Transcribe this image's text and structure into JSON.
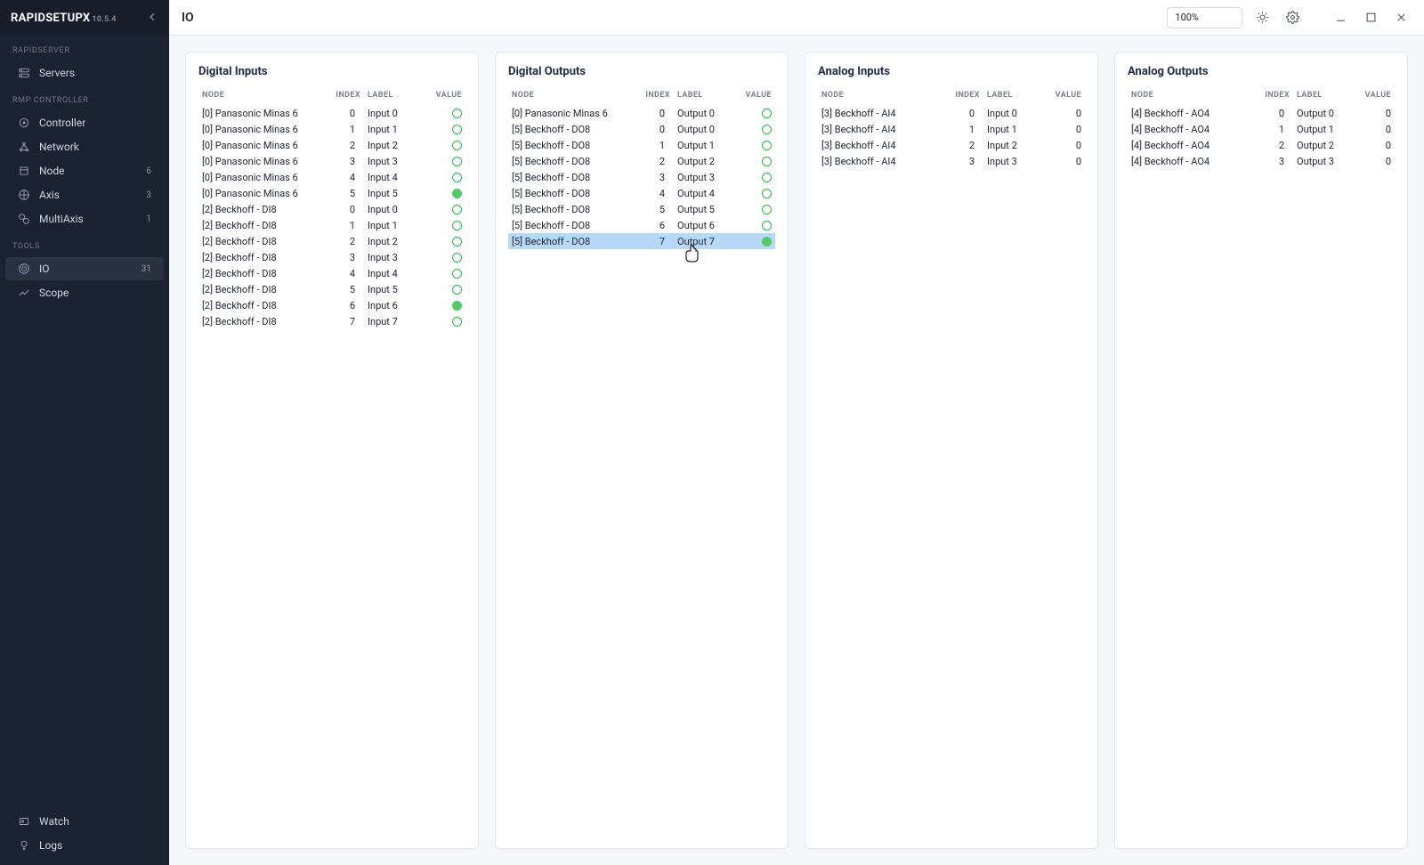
{
  "app": {
    "name": "RAPIDSETUPX",
    "version": "10.5.4",
    "page_title": "IO"
  },
  "zoom": {
    "level": "100%"
  },
  "sidebar": {
    "groups": [
      {
        "label": "RAPIDSERVER",
        "items": [
          {
            "id": "servers",
            "label": "Servers",
            "icon": "servers",
            "badge": "",
            "active": false
          }
        ]
      },
      {
        "label": "RMP CONTROLLER",
        "items": [
          {
            "id": "controller",
            "label": "Controller",
            "icon": "controller",
            "badge": "",
            "active": false
          },
          {
            "id": "network",
            "label": "Network",
            "icon": "network",
            "badge": "",
            "active": false
          },
          {
            "id": "node",
            "label": "Node",
            "icon": "node",
            "badge": "6",
            "active": false
          },
          {
            "id": "axis",
            "label": "Axis",
            "icon": "axis",
            "badge": "3",
            "active": false
          },
          {
            "id": "multiaxis",
            "label": "MultiAxis",
            "icon": "multiaxis",
            "badge": "1",
            "active": false
          }
        ]
      },
      {
        "label": "TOOLS",
        "items": [
          {
            "id": "io",
            "label": "IO",
            "icon": "io",
            "badge": "31",
            "active": true
          },
          {
            "id": "scope",
            "label": "Scope",
            "icon": "scope",
            "badge": "",
            "active": false
          }
        ]
      }
    ],
    "bottom": [
      {
        "id": "watch",
        "label": "Watch",
        "icon": "watch"
      },
      {
        "id": "logs",
        "label": "Logs",
        "icon": "logs"
      }
    ]
  },
  "headers": {
    "node": "NODE",
    "index": "INDEX",
    "label": "LABEL",
    "value": "VALUE"
  },
  "panels": [
    {
      "id": "din",
      "title": "Digital Inputs",
      "type": "digital",
      "rows": [
        {
          "node": "[0] Panasonic Minas 6",
          "index": 0,
          "label": "Input 0",
          "on": false
        },
        {
          "node": "[0] Panasonic Minas 6",
          "index": 1,
          "label": "Input 1",
          "on": false
        },
        {
          "node": "[0] Panasonic Minas 6",
          "index": 2,
          "label": "Input 2",
          "on": false
        },
        {
          "node": "[0] Panasonic Minas 6",
          "index": 3,
          "label": "Input 3",
          "on": false
        },
        {
          "node": "[0] Panasonic Minas 6",
          "index": 4,
          "label": "Input 4",
          "on": false
        },
        {
          "node": "[0] Panasonic Minas 6",
          "index": 5,
          "label": "Input 5",
          "on": true
        },
        {
          "node": "[2] Beckhoff - DI8",
          "index": 0,
          "label": "Input 0",
          "on": false
        },
        {
          "node": "[2] Beckhoff - DI8",
          "index": 1,
          "label": "Input 1",
          "on": false
        },
        {
          "node": "[2] Beckhoff - DI8",
          "index": 2,
          "label": "Input 2",
          "on": false
        },
        {
          "node": "[2] Beckhoff - DI8",
          "index": 3,
          "label": "Input 3",
          "on": false
        },
        {
          "node": "[2] Beckhoff - DI8",
          "index": 4,
          "label": "Input 4",
          "on": false
        },
        {
          "node": "[2] Beckhoff - DI8",
          "index": 5,
          "label": "Input 5",
          "on": false
        },
        {
          "node": "[2] Beckhoff - DI8",
          "index": 6,
          "label": "Input 6",
          "on": true
        },
        {
          "node": "[2] Beckhoff - DI8",
          "index": 7,
          "label": "Input 7",
          "on": false
        }
      ]
    },
    {
      "id": "dout",
      "title": "Digital Outputs",
      "type": "digital",
      "rows": [
        {
          "node": "[0] Panasonic Minas 6",
          "index": 0,
          "label": "Output 0",
          "on": false
        },
        {
          "node": "[5] Beckhoff - DO8",
          "index": 0,
          "label": "Output 0",
          "on": false
        },
        {
          "node": "[5] Beckhoff - DO8",
          "index": 1,
          "label": "Output 1",
          "on": false
        },
        {
          "node": "[5] Beckhoff - DO8",
          "index": 2,
          "label": "Output 2",
          "on": false
        },
        {
          "node": "[5] Beckhoff - DO8",
          "index": 3,
          "label": "Output 3",
          "on": false
        },
        {
          "node": "[5] Beckhoff - DO8",
          "index": 4,
          "label": "Output 4",
          "on": false
        },
        {
          "node": "[5] Beckhoff - DO8",
          "index": 5,
          "label": "Output 5",
          "on": false
        },
        {
          "node": "[5] Beckhoff - DO8",
          "index": 6,
          "label": "Output 6",
          "on": false
        },
        {
          "node": "[5] Beckhoff - DO8",
          "index": 7,
          "label": "Output 7",
          "on": true,
          "selected": true
        }
      ]
    },
    {
      "id": "ain",
      "title": "Analog Inputs",
      "type": "analog",
      "rows": [
        {
          "node": "[3] Beckhoff - AI4",
          "index": 0,
          "label": "Input 0",
          "value": 0
        },
        {
          "node": "[3] Beckhoff - AI4",
          "index": 1,
          "label": "Input 1",
          "value": 0
        },
        {
          "node": "[3] Beckhoff - AI4",
          "index": 2,
          "label": "Input 2",
          "value": 0
        },
        {
          "node": "[3] Beckhoff - AI4",
          "index": 3,
          "label": "Input 3",
          "value": 0
        }
      ]
    },
    {
      "id": "aout",
      "title": "Analog Outputs",
      "type": "analog",
      "rows": [
        {
          "node": "[4] Beckhoff - AO4",
          "index": 0,
          "label": "Output 0",
          "value": 0
        },
        {
          "node": "[4] Beckhoff - AO4",
          "index": 1,
          "label": "Output 1",
          "value": 0
        },
        {
          "node": "[4] Beckhoff - AO4",
          "index": 2,
          "label": "Output 2",
          "value": 0
        },
        {
          "node": "[4] Beckhoff - AO4",
          "index": 3,
          "label": "Output 3",
          "value": 0
        }
      ]
    }
  ]
}
